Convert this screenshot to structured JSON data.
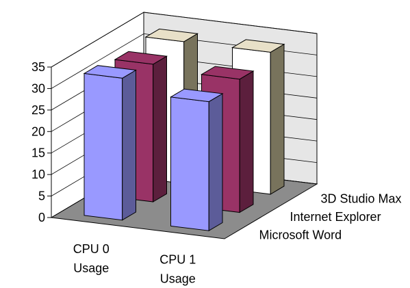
{
  "chart_data": {
    "type": "bar",
    "categories": [
      "CPU 0 Usage",
      "CPU 1 Usage"
    ],
    "category_lines": [
      [
        "CPU 0",
        "Usage"
      ],
      [
        "CPU 1",
        "Usage"
      ]
    ],
    "series": [
      {
        "name": "Microsoft Word",
        "values": [
          33,
          30
        ],
        "color": "#9999ff"
      },
      {
        "name": "Internet Explorer",
        "values": [
          32,
          31
        ],
        "color": "#993366"
      },
      {
        "name": "3D Studio Max",
        "values": [
          33,
          33
        ],
        "color": "#ffffff"
      }
    ],
    "yticks": [
      0,
      5,
      10,
      15,
      20,
      25,
      30,
      35
    ],
    "ylim": [
      0,
      35
    ],
    "grid": true
  }
}
